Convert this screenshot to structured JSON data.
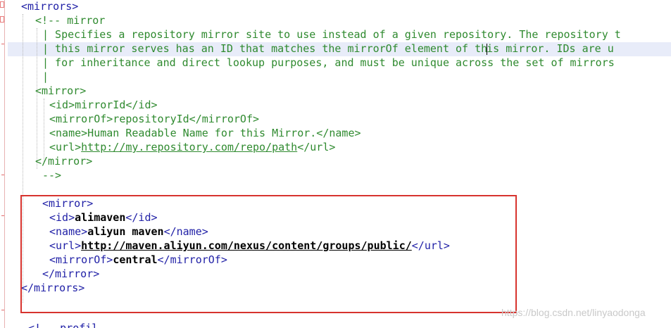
{
  "editor": {
    "lines": [
      {
        "id": "mirrors-open",
        "segments": [
          {
            "t": "tag",
            "text": "<mirrors>"
          }
        ]
      },
      {
        "id": "comment-start",
        "segments": [
          {
            "t": "cmt",
            "text": "<!-- mirror"
          }
        ]
      },
      {
        "id": "comment-1",
        "segments": [
          {
            "t": "cmt",
            "text": "| Specifies a repository mirror site to use instead of a given repository. The repository t"
          }
        ]
      },
      {
        "id": "comment-2",
        "segments": [
          {
            "t": "cmt",
            "text": "| this mirror serves has an ID that matches the mirrorOf element of th"
          },
          {
            "t": "caret",
            "text": ""
          },
          {
            "t": "cmt",
            "text": "is mirror. IDs are u"
          }
        ]
      },
      {
        "id": "comment-3",
        "segments": [
          {
            "t": "cmt",
            "text": "| for inheritance and direct lookup purposes, and must be unique across the set of mirrors"
          }
        ]
      },
      {
        "id": "comment-4",
        "segments": [
          {
            "t": "cmt",
            "text": "|"
          }
        ]
      },
      {
        "id": "comment-mirror-open",
        "segments": [
          {
            "t": "cmt",
            "text": "<mirror>"
          }
        ]
      },
      {
        "id": "comment-id",
        "segments": [
          {
            "t": "cmt",
            "text": "<id>mirrorId</id>"
          }
        ]
      },
      {
        "id": "comment-mirrorof",
        "segments": [
          {
            "t": "cmt",
            "text": "<mirrorOf>repositoryId</mirrorOf>"
          }
        ]
      },
      {
        "id": "comment-name",
        "segments": [
          {
            "t": "cmt",
            "text": "<name>Human Readable Name for this Mirror.</name>"
          }
        ]
      },
      {
        "id": "comment-url",
        "segments": [
          {
            "t": "cmt",
            "text": "<url>"
          },
          {
            "t": "cmt-link",
            "text": "http://my.repository.com/repo/path"
          },
          {
            "t": "cmt",
            "text": "</url>"
          }
        ]
      },
      {
        "id": "comment-mirror-close",
        "segments": [
          {
            "t": "cmt",
            "text": "</mirror>"
          }
        ]
      },
      {
        "id": "comment-end",
        "segments": [
          {
            "t": "cmt",
            "text": "-->"
          }
        ]
      },
      {
        "id": "blank",
        "segments": []
      },
      {
        "id": "mirror-open",
        "segments": [
          {
            "t": "tag",
            "text": "<mirror>"
          }
        ]
      },
      {
        "id": "mirror-id",
        "segments": [
          {
            "t": "tag",
            "text": "<id>"
          },
          {
            "t": "val",
            "text": "alimaven"
          },
          {
            "t": "tag",
            "text": "</id>"
          }
        ]
      },
      {
        "id": "mirror-name",
        "segments": [
          {
            "t": "tag",
            "text": "<name>"
          },
          {
            "t": "val",
            "text": "aliyun maven"
          },
          {
            "t": "tag",
            "text": "</name>"
          }
        ]
      },
      {
        "id": "mirror-url",
        "segments": [
          {
            "t": "tag",
            "text": "<url>"
          },
          {
            "t": "val-link",
            "text": "http://maven.aliyun.com/nexus/content/groups/public/"
          },
          {
            "t": "tag",
            "text": "</url>"
          }
        ]
      },
      {
        "id": "mirror-mirrorof",
        "segments": [
          {
            "t": "tag",
            "text": "<mirrorOf>"
          },
          {
            "t": "val",
            "text": "central"
          },
          {
            "t": "tag",
            "text": "</mirrorOf>"
          }
        ]
      },
      {
        "id": "mirror-close",
        "segments": [
          {
            "t": "tag",
            "text": "</mirror>"
          }
        ]
      },
      {
        "id": "mirrors-close",
        "segments": [
          {
            "t": "tag",
            "text": "</mirrors>"
          }
        ]
      }
    ],
    "cut_line": "<!-- profil"
  },
  "watermark": "https://blog.csdn.net/linyaodonga",
  "colors": {
    "tag": "#1f1fa6",
    "comment": "#2f8a2f",
    "value": "#000000",
    "highlight_box": "#d7332e",
    "current_line": "#e8ecf9"
  }
}
